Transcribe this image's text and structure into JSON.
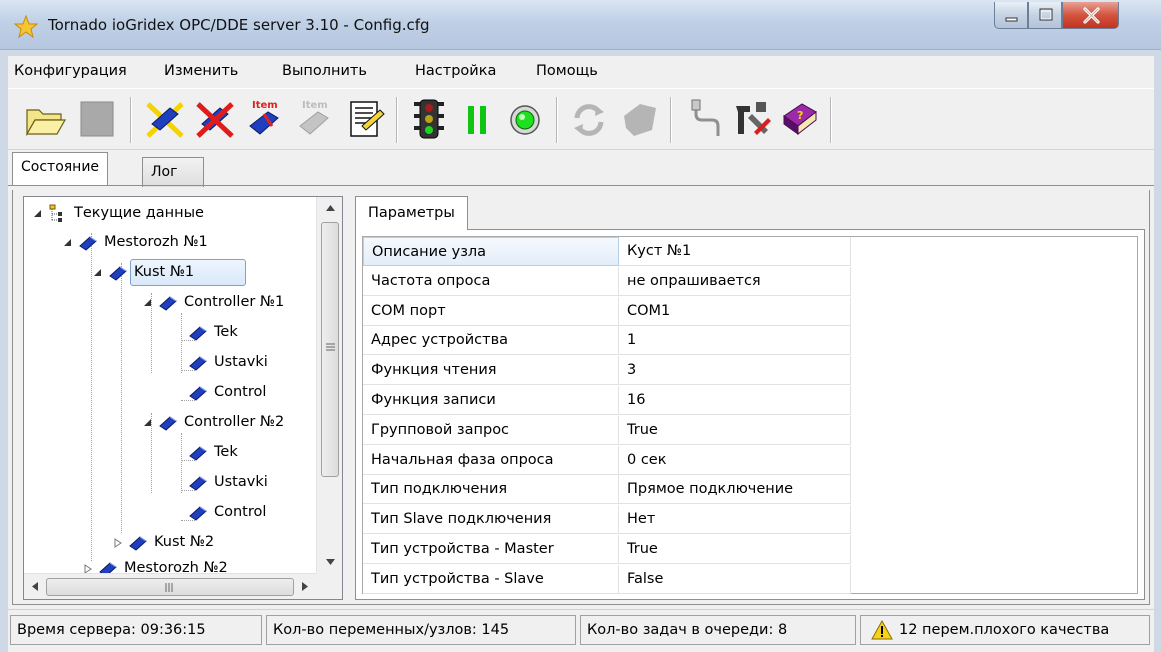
{
  "window": {
    "title": "Tornado ioGridex OPC/DDE server 3.10 - Config.cfg"
  },
  "menu": [
    "Конфигурация",
    "Изменить",
    "Выполнить",
    "Настройка",
    "Помощь"
  ],
  "toolbar": {
    "buttons": [
      "open-folder-icon",
      "stop-icon",
      "add-node-icon",
      "delete-node-icon",
      "add-item-icon",
      "remove-item-icon",
      "properties-icon",
      "traffic-light-icon",
      "pause-icon",
      "record-icon",
      "refresh-icon",
      "shape-icon",
      "connector-icon",
      "tools-icon",
      "help-book-icon"
    ]
  },
  "tabs": [
    {
      "label": "Состояние",
      "active": true
    },
    {
      "label": "Лог",
      "active": false
    }
  ],
  "tree": {
    "root": "Текущие данные",
    "nodes": [
      {
        "label": "Mestorozh №1",
        "level": 1,
        "expanded": true
      },
      {
        "label": "Kust №1",
        "level": 2,
        "expanded": true,
        "selected": true
      },
      {
        "label": "Controller №1",
        "level": 3,
        "expanded": true
      },
      {
        "label": "Tek",
        "level": 4
      },
      {
        "label": "Ustavki",
        "level": 4
      },
      {
        "label": "Control",
        "level": 4
      },
      {
        "label": "Controller №2",
        "level": 3,
        "expanded": true
      },
      {
        "label": "Tek",
        "level": 4
      },
      {
        "label": "Ustavki",
        "level": 4
      },
      {
        "label": "Control",
        "level": 4
      },
      {
        "label": "Kust №2",
        "level": 2,
        "expanded": false
      },
      {
        "label": "Mestorozh №2",
        "level": 1,
        "expanded": false
      }
    ]
  },
  "params": {
    "tab": "Параметры",
    "rows": [
      {
        "key": "Описание узла",
        "value": "Куст №1"
      },
      {
        "key": "Частота опроса",
        "value": "не опрашивается"
      },
      {
        "key": "COM порт",
        "value": "COM1"
      },
      {
        "key": "Адрес устройства",
        "value": "1"
      },
      {
        "key": "Функция чтения",
        "value": "3"
      },
      {
        "key": "Функция записи",
        "value": "16"
      },
      {
        "key": "Групповой запрос",
        "value": "True"
      },
      {
        "key": "Начальная фаза опроса",
        "value": "0 сек"
      },
      {
        "key": "Тип подключения",
        "value": "Прямое подключение"
      },
      {
        "key": "Тип Slave подключения",
        "value": "Нет"
      },
      {
        "key": "Тип устройства - Master",
        "value": "True"
      },
      {
        "key": "Тип устройства - Slave",
        "value": "False"
      }
    ]
  },
  "status": {
    "server_time": "Время сервера: 09:36:15",
    "vars_count": "Кол-во переменных/узлов: 145",
    "queue": "Кол-во задач в очереди: 8",
    "bad_quality": "12 перем.плохого качества"
  },
  "colors": {
    "accent": "#1f3fbf",
    "window": "#f0f0f0",
    "selection": "#d9e8f9"
  }
}
